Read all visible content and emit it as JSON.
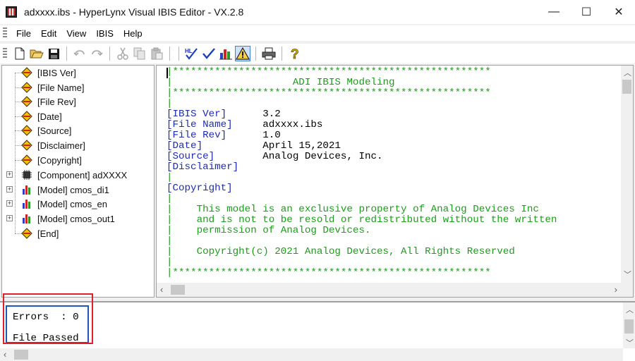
{
  "window": {
    "title": "adxxxx.ibs - HyperLynx Visual IBIS Editor - VX.2.8",
    "minimize": "—",
    "maximize": "☐",
    "close": "✕"
  },
  "menu": [
    "File",
    "Edit",
    "View",
    "IBIS",
    "Help"
  ],
  "toolbar": {
    "icons": [
      "new-file-icon",
      "open-folder-icon",
      "save-icon",
      "separator",
      "undo-icon",
      "redo-icon",
      "separator",
      "cut-icon",
      "copy-icon",
      "paste-icon",
      "separator",
      "hyperlynx-check-icon",
      "check-icon",
      "chart-icon",
      "warning-icon",
      "separator",
      "print-icon",
      "help-icon"
    ],
    "hl_badge": "HL"
  },
  "tree": {
    "items": [
      {
        "label": "[IBIS Ver]",
        "icon": "keyword-icon"
      },
      {
        "label": "[File Name]",
        "icon": "keyword-icon"
      },
      {
        "label": "[File Rev]",
        "icon": "keyword-icon"
      },
      {
        "label": "[Date]",
        "icon": "keyword-icon"
      },
      {
        "label": "[Source]",
        "icon": "keyword-icon"
      },
      {
        "label": "[Disclaimer]",
        "icon": "keyword-icon"
      },
      {
        "label": "[Copyright]",
        "icon": "keyword-icon"
      },
      {
        "label": "[Component] adXXXX",
        "icon": "component-icon",
        "expandable": true
      },
      {
        "label": "[Model] cmos_di1",
        "icon": "model-icon",
        "expandable": true
      },
      {
        "label": "[Model] cmos_en",
        "icon": "model-icon",
        "expandable": true
      },
      {
        "label": "[Model] cmos_out1",
        "icon": "model-icon",
        "expandable": true
      },
      {
        "label": "[End]",
        "icon": "keyword-icon"
      }
    ]
  },
  "editor": {
    "border_line": "|*****************************************************",
    "banner_title": "|                    ADI IBIS Modeling",
    "pipe": "|",
    "fields": [
      {
        "key": "[IBIS Ver]",
        "pad": "      ",
        "value": "3.2"
      },
      {
        "key": "[File Name]",
        "pad": "     ",
        "value": "adxxxx.ibs"
      },
      {
        "key": "[File Rev]",
        "pad": "      ",
        "value": "1.0"
      },
      {
        "key": "[Date]",
        "pad": "          ",
        "value": "April 15,2021"
      },
      {
        "key": "[Source]",
        "pad": "        ",
        "value": "Analog Devices, Inc."
      },
      {
        "key": "[Disclaimer]",
        "pad": "",
        "value": ""
      }
    ],
    "copyright_key": "[Copyright]",
    "copyright_lines": [
      "|    This model is an exclusive property of Analog Devices Inc",
      "|    and is not to be resold or redistributed without the written",
      "|    permission of Analog Devices."
    ],
    "copyright_notice": "|    Copyright(c) 2021 Analog Devices, All Rights Reserved"
  },
  "output": {
    "errors_line": "Errors  : 0",
    "status_line": "File Passed"
  },
  "colors": {
    "comment_green": "#1d9b1d",
    "keyword_blue": "#1e2bb3",
    "highlight_red": "#e0202a",
    "box_blue": "#1e57b8"
  }
}
